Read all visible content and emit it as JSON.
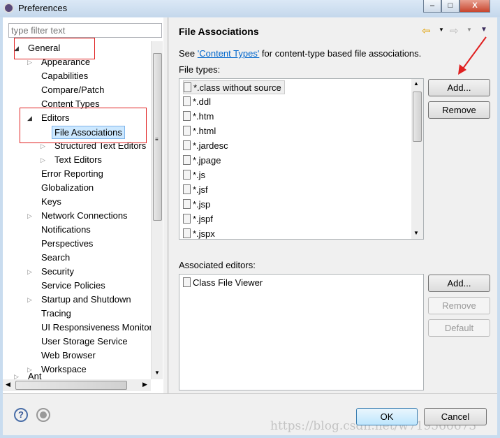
{
  "window": {
    "title": "Preferences"
  },
  "filter": {
    "placeholder": "type filter text"
  },
  "tree": [
    {
      "label": "General",
      "level": 0,
      "expanded": true
    },
    {
      "label": "Appearance",
      "level": 1,
      "collapsed": true
    },
    {
      "label": "Capabilities",
      "level": 1
    },
    {
      "label": "Compare/Patch",
      "level": 1
    },
    {
      "label": "Content Types",
      "level": 1
    },
    {
      "label": "Editors",
      "level": 1,
      "expanded": true
    },
    {
      "label": "File Associations",
      "level": 2,
      "selected": true
    },
    {
      "label": "Structured Text Editors",
      "level": 2,
      "collapsed": true
    },
    {
      "label": "Text Editors",
      "level": 2,
      "collapsed": true
    },
    {
      "label": "Error Reporting",
      "level": 1
    },
    {
      "label": "Globalization",
      "level": 1
    },
    {
      "label": "Keys",
      "level": 1
    },
    {
      "label": "Network Connections",
      "level": 1,
      "collapsed": true
    },
    {
      "label": "Notifications",
      "level": 1
    },
    {
      "label": "Perspectives",
      "level": 1
    },
    {
      "label": "Search",
      "level": 1
    },
    {
      "label": "Security",
      "level": 1,
      "collapsed": true
    },
    {
      "label": "Service Policies",
      "level": 1
    },
    {
      "label": "Startup and Shutdown",
      "level": 1,
      "collapsed": true
    },
    {
      "label": "Tracing",
      "level": 1
    },
    {
      "label": "UI Responsiveness Monitor",
      "level": 1
    },
    {
      "label": "User Storage Service",
      "level": 1
    },
    {
      "label": "Web Browser",
      "level": 1
    },
    {
      "label": "Workspace",
      "level": 1,
      "collapsed": true
    },
    {
      "label": "Ant",
      "level": 0,
      "collapsed": true
    }
  ],
  "page": {
    "title": "File Associations",
    "see_prefix": "See ",
    "see_link": "'Content Types'",
    "see_suffix": " for content-type based file associations.",
    "file_types_label": "File types:",
    "file_types": [
      "*.class without source",
      "*.ddl",
      "*.htm",
      "*.html",
      "*.jardesc",
      "*.jpage",
      "*.js",
      "*.jsf",
      "*.jsp",
      "*.jspf",
      "*.jspx"
    ],
    "add": "Add...",
    "remove": "Remove",
    "editors_label": "Associated editors:",
    "editors": [
      "Class File Viewer"
    ],
    "editors_add": "Add...",
    "editors_remove": "Remove",
    "editors_default": "Default"
  },
  "footer": {
    "ok": "OK",
    "cancel": "Cancel",
    "watermark": "https://blog.csdn.net/w719566673"
  },
  "colors": {
    "selection": "#cce8ff",
    "link": "#0066cc",
    "annotation": "#e02020"
  }
}
